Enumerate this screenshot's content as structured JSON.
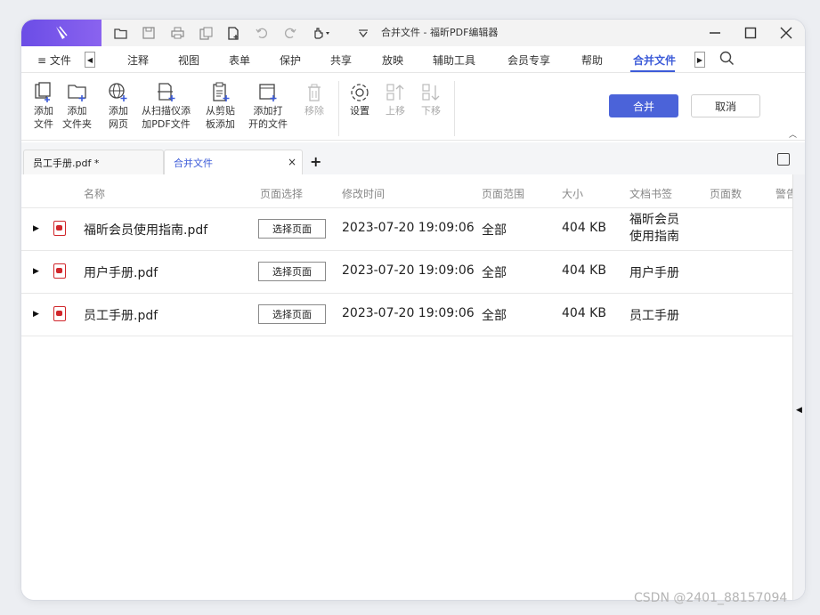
{
  "window": {
    "title": "合并文件 - 福昕PDF编辑器"
  },
  "menubar": {
    "file_label": "文件",
    "items": [
      "注释",
      "视图",
      "表单",
      "保护",
      "共享",
      "放映",
      "辅助工具",
      "会员专享",
      "帮助",
      "合并文件"
    ],
    "active": "合并文件"
  },
  "ribbon": {
    "buttons": [
      {
        "label1": "添加",
        "label2": "文件",
        "icon": "add-file-icon"
      },
      {
        "label1": "添加",
        "label2": "文件夹",
        "icon": "add-folder-icon"
      },
      {
        "label1": "添加",
        "label2": "网页",
        "icon": "add-webpage-icon"
      },
      {
        "label1": "从扫描仪添",
        "label2": "加PDF文件",
        "icon": "scanner-icon"
      },
      {
        "label1": "从剪贴",
        "label2": "板添加",
        "icon": "clipboard-icon"
      },
      {
        "label1": "添加打",
        "label2": "开的文件",
        "icon": "open-files-icon"
      },
      {
        "label1": "移除",
        "label2": "",
        "icon": "trash-icon"
      },
      {
        "label1": "设置",
        "label2": "",
        "icon": "gear-icon"
      },
      {
        "label1": "上移",
        "label2": "",
        "icon": "move-up-icon"
      },
      {
        "label1": "下移",
        "label2": "",
        "icon": "move-down-icon"
      }
    ],
    "merge_label": "合并",
    "cancel_label": "取消",
    "colors": {
      "primary": "#4b63d9"
    }
  },
  "tabs": [
    {
      "label": "员工手册.pdf *"
    },
    {
      "label": "合并文件",
      "close": "×"
    }
  ],
  "add_tab": "+",
  "table": {
    "headers": [
      "名称",
      "页面选择",
      "修改时间",
      "页面范围",
      "大小",
      "文档书签",
      "页面数",
      "警告"
    ],
    "rows": [
      {
        "name": "福昕会员使用指南.pdf",
        "select": "选择页面",
        "modified": "2023-07-20 19:09:06",
        "range": "全部",
        "size": "404 KB",
        "bookmark_line1": "福昕会员",
        "bookmark_line2": "使用指南"
      },
      {
        "name": "用户手册.pdf",
        "select": "选择页面",
        "modified": "2023-07-20 19:09:06",
        "range": "全部",
        "size": "404 KB",
        "bookmark": "用户手册"
      },
      {
        "name": "员工手册.pdf",
        "select": "选择页面",
        "modified": "2023-07-20 19:09:06",
        "range": "全部",
        "size": "404 KB",
        "bookmark": "员工手册"
      }
    ]
  },
  "watermark": "CSDN @2401_88157094"
}
